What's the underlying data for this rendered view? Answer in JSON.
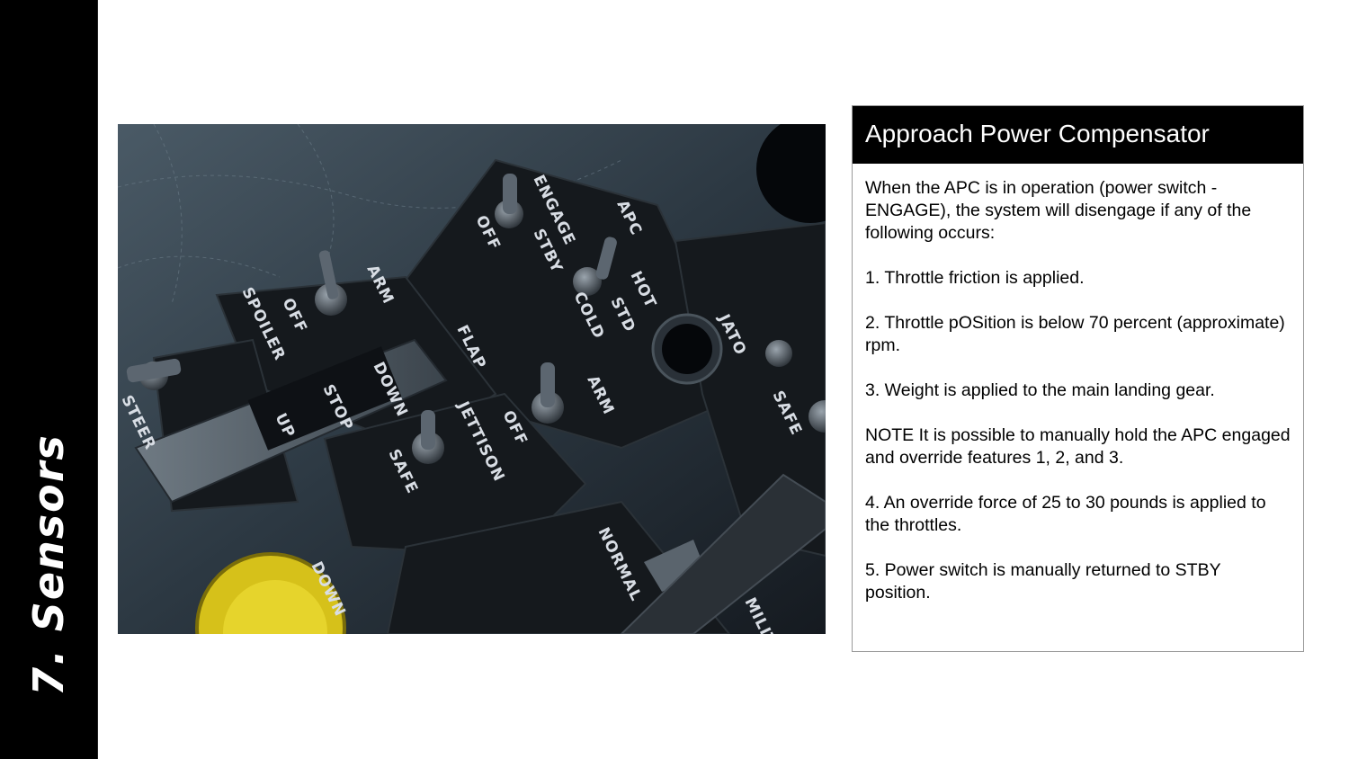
{
  "sidebar": {
    "title": "7. Sensors"
  },
  "photo": {
    "labels": {
      "apc": "APC",
      "engage": "ENGAGE",
      "off1": "OFF",
      "stby": "STBY",
      "hot": "HOT",
      "std": "STD",
      "cold": "COLD",
      "arm1": "ARM",
      "off2": "OFF",
      "spoiler": "SPOILER",
      "flap": "FLAP",
      "down1": "DOWN",
      "stop": "STOP",
      "up": "UP",
      "jettison": "JETTISON",
      "safe1": "SAFE",
      "off3": "OFF",
      "arm2": "ARM",
      "jato": "JATO",
      "safe2": "SAFE",
      "normal": "NORMAL",
      "down2": "DOWN",
      "steer": "STEER",
      "mil": "MILIT"
    }
  },
  "panel": {
    "title": "Approach Power Compensator",
    "intro": "When the APC is in operation (power switch - ENGAGE), the system will disengage if any of the following occurs:",
    "item1": " 1. Throttle friction is applied.",
    "item2": " 2. Throttle pOSition is below 70 percent (approximate) rpm.",
    "item3": " 3. Weight is applied to the main landing gear.",
    "note": "NOTE It is possible to manually hold the APC engaged and override features 1, 2, and 3.",
    "item4": " 4. An override force of 25 to 30 pounds is applied to the throttles.",
    "item5": " 5. Power switch is manually returned to STBY position."
  }
}
